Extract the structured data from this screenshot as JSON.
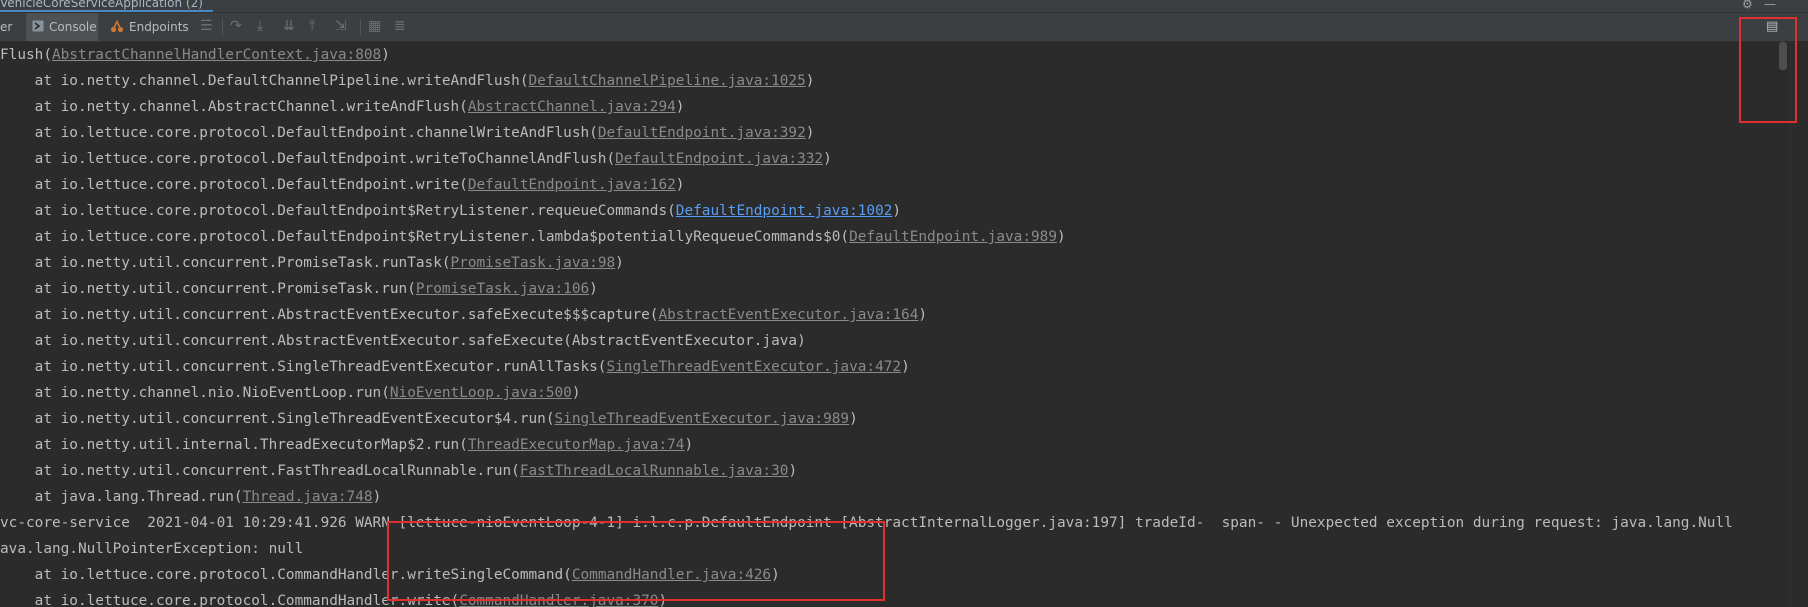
{
  "run_tab": {
    "label": "VehicleCoreServiceApplication (2)"
  },
  "toolbar": {
    "partial_tab": "er",
    "console_tab": "Console",
    "endpoints_tab": "Endpoints"
  },
  "console_lines": [
    {
      "pre": "Flush(",
      "link": "AbstractChannelHandlerContext.java:808",
      "post": ")"
    },
    {
      "pre": "    at io.netty.channel.DefaultChannelPipeline.writeAndFlush(",
      "link": "DefaultChannelPipeline.java:1025",
      "post": ")"
    },
    {
      "pre": "    at io.netty.channel.AbstractChannel.writeAndFlush(",
      "link": "AbstractChannel.java:294",
      "post": ")"
    },
    {
      "pre": "    at io.lettuce.core.protocol.DefaultEndpoint.channelWriteAndFlush(",
      "link": "DefaultEndpoint.java:392",
      "post": ")"
    },
    {
      "pre": "    at io.lettuce.core.protocol.DefaultEndpoint.writeToChannelAndFlush(",
      "link": "DefaultEndpoint.java:332",
      "post": ")"
    },
    {
      "pre": "    at io.lettuce.core.protocol.DefaultEndpoint.write(",
      "link": "DefaultEndpoint.java:162",
      "post": ")"
    },
    {
      "pre": "    at io.lettuce.core.protocol.DefaultEndpoint$RetryListener.requeueCommands(",
      "link": "DefaultEndpoint.java:1002",
      "post": ")",
      "highlight": true
    },
    {
      "pre": "    at io.lettuce.core.protocol.DefaultEndpoint$RetryListener.lambda$potentiallyRequeueCommands$0(",
      "link": "DefaultEndpoint.java:989",
      "post": ")"
    },
    {
      "pre": "    at io.netty.util.concurrent.PromiseTask.runTask(",
      "link": "PromiseTask.java:98",
      "post": ")"
    },
    {
      "pre": "    at io.netty.util.concurrent.PromiseTask.run(",
      "link": "PromiseTask.java:106",
      "post": ")"
    },
    {
      "pre": "    at io.netty.util.concurrent.AbstractEventExecutor.safeExecute$$$capture(",
      "link": "AbstractEventExecutor.java:164",
      "post": ")"
    },
    {
      "pre": "    at io.netty.util.concurrent.AbstractEventExecutor.safeExecute(AbstractEventExecutor.java)",
      "link": "",
      "post": ""
    },
    {
      "pre": "    at io.netty.util.concurrent.SingleThreadEventExecutor.runAllTasks(",
      "link": "SingleThreadEventExecutor.java:472",
      "post": ")"
    },
    {
      "pre": "    at io.netty.channel.nio.NioEventLoop.run(",
      "link": "NioEventLoop.java:500",
      "post": ")"
    },
    {
      "pre": "    at io.netty.util.concurrent.SingleThreadEventExecutor$4.run(",
      "link": "SingleThreadEventExecutor.java:989",
      "post": ")"
    },
    {
      "pre": "    at io.netty.util.internal.ThreadExecutorMap$2.run(",
      "link": "ThreadExecutorMap.java:74",
      "post": ")"
    },
    {
      "pre": "    at io.netty.util.concurrent.FastThreadLocalRunnable.run(",
      "link": "FastThreadLocalRunnable.java:30",
      "post": ")"
    },
    {
      "pre": "    at java.lang.Thread.run(",
      "link": "Thread.java:748",
      "post": ")"
    },
    {
      "pre": "vc-core-service  2021-04-01 10:29:41.926 WARN [lettuce-nioEventLoop-4-1] i.l.c.p.DefaultEndpoint [AbstractInternalLogger.java:197] tradeId-  span- - Unexpected exception during request: java.lang.Null",
      "link": "",
      "post": ""
    },
    {
      "pre": "ava.lang.NullPointerException: null",
      "link": "",
      "post": ""
    },
    {
      "pre": "    at io.lettuce.core.protocol.CommandHandler.writeSingleCommand(",
      "link": "CommandHandler.java:426",
      "post": ")"
    },
    {
      "pre": "    at io.lettuce.core.protocol.CommandHandler.write(",
      "link": "CommandHandler.java:370",
      "post": ")"
    }
  ],
  "icons": {
    "console_tab": "console-icon",
    "endpoints_tab": "endpoints-icon",
    "layout": "layout-icon"
  },
  "colors": {
    "background": "#2b2b2b",
    "text": "#bbbbbb",
    "link": "#8a8a8a",
    "active_link": "#589df6",
    "annotation": "#e03030"
  }
}
